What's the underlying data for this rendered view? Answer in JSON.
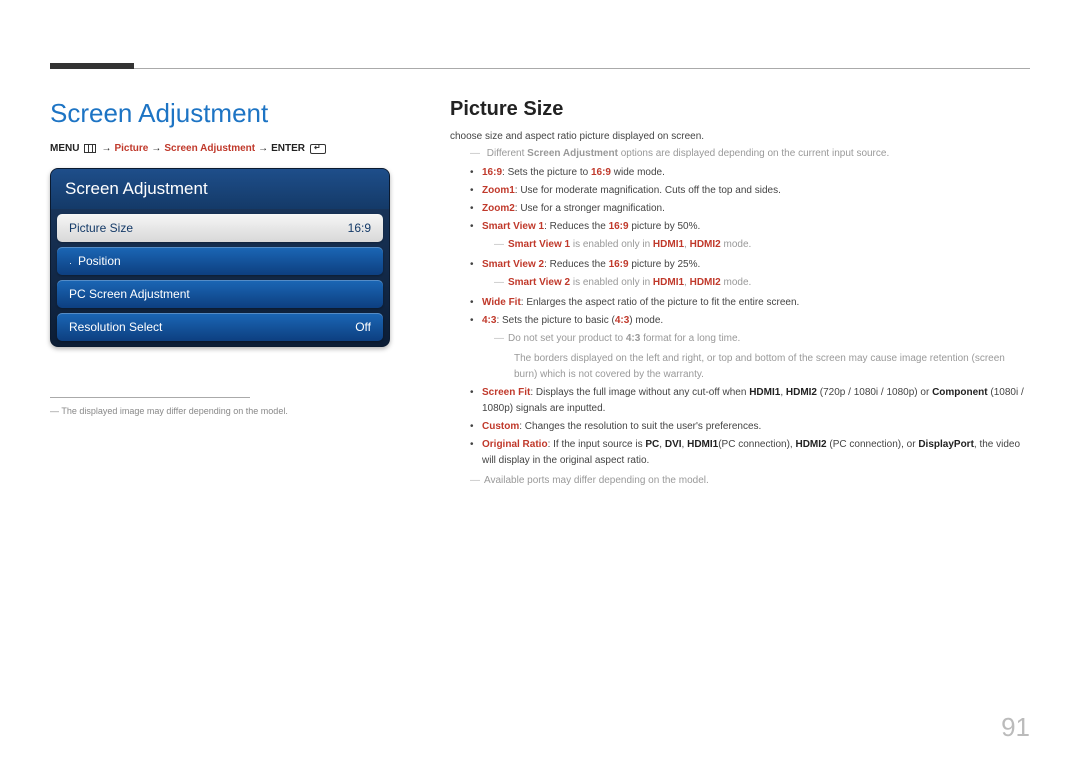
{
  "page_number": "91",
  "left": {
    "title": "Screen Adjustment",
    "breadcrumb": {
      "menu": "MENU",
      "arrow": "→",
      "p1": "Picture",
      "p2": "Screen Adjustment",
      "enter": "ENTER"
    },
    "osd": {
      "header": "Screen Adjustment",
      "rows": [
        {
          "label": "Picture Size",
          "value": "16:9",
          "selected": true
        },
        {
          "label": "Position",
          "value": "",
          "bullet": true
        },
        {
          "label": "PC Screen Adjustment",
          "value": ""
        },
        {
          "label": "Resolution Select",
          "value": "Off"
        }
      ]
    },
    "footnote": "The displayed image may differ depending on the model."
  },
  "right": {
    "title": "Picture Size",
    "intro": "choose size and aspect ratio picture displayed on screen.",
    "note_top_pre": "Different ",
    "note_top_bold": "Screen Adjustment",
    "note_top_post": " options are displayed depending on the current input source.",
    "items": {
      "i1_a": "16:9",
      "i1_b": ": Sets the picture to ",
      "i1_c": "16:9",
      "i1_d": " wide mode.",
      "i2_a": "Zoom1",
      "i2_b": ": Use for moderate magnification. Cuts off the top and sides.",
      "i3_a": "Zoom2",
      "i3_b": ": Use for a stronger magnification.",
      "i4_a": "Smart View 1",
      "i4_b": ": Reduces the ",
      "i4_c": "16:9",
      "i4_d": " picture by 50%.",
      "i4n_a": "Smart View 1",
      "i4n_b": " is enabled only in ",
      "i4n_c": "HDMI1",
      "i4n_d": ", ",
      "i4n_e": "HDMI2",
      "i4n_f": " mode.",
      "i5_a": "Smart View 2",
      "i5_b": ": Reduces the ",
      "i5_c": "16:9",
      "i5_d": " picture by 25%.",
      "i5n_a": "Smart View 2",
      "i5n_b": " is enabled only in ",
      "i5n_c": "HDMI1",
      "i5n_d": ", ",
      "i5n_e": "HDMI2",
      "i5n_f": " mode.",
      "i6_a": "Wide Fit",
      "i6_b": ": Enlarges the aspect ratio of the picture to fit the entire screen.",
      "i7_a": "4:3",
      "i7_b": ": Sets the picture to basic (",
      "i7_c": "4:3",
      "i7_d": ") mode.",
      "i7n_a": "Do not set your product to ",
      "i7n_b": "4:3",
      "i7n_c": " format for a long time.",
      "i7n2": "The borders displayed on the left and right, or top and bottom of the screen may cause image retention (screen burn) which is not covered by the warranty.",
      "i8_a": "Screen Fit",
      "i8_b": ": Displays the full image without any cut-off when ",
      "i8_c": "HDMI1",
      "i8_d": ", ",
      "i8_e": "HDMI2",
      "i8_f": " (720p / 1080i / 1080p) or ",
      "i8_g": "Component",
      "i8_h": " (1080i / 1080p) signals are inputted.",
      "i9_a": "Custom",
      "i9_b": ": Changes the resolution to suit the user's preferences.",
      "i10_a": "Original Ratio",
      "i10_b": ": If the input source is ",
      "i10_c": "PC",
      "i10_d": ", ",
      "i10_e": "DVI",
      "i10_f": ", ",
      "i10_g": "HDMI1",
      "i10_h": "(PC connection), ",
      "i10_i": "HDMI2",
      "i10_j": " (PC connection), or ",
      "i10_k": "DisplayPort",
      "i10_l": ", the video will display in the original aspect ratio.",
      "note_bottom": "Available ports may differ depending on the model."
    }
  }
}
